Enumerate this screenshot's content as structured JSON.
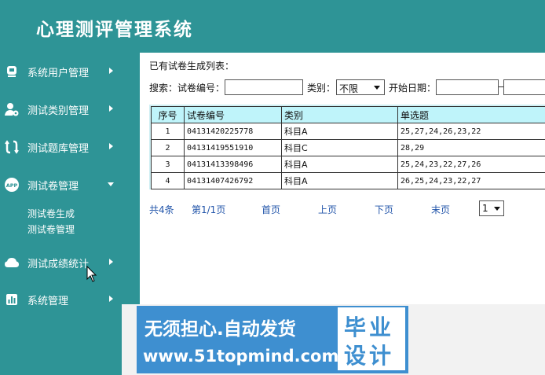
{
  "app": {
    "title": "心理测评管理系统"
  },
  "sidebar": {
    "items": [
      {
        "label": "系统用户管理",
        "icon": "user-icon"
      },
      {
        "label": "测试类别管理",
        "icon": "user-gear-icon"
      },
      {
        "label": "测试题库管理",
        "icon": "bank-icon"
      },
      {
        "label": "测试卷管理",
        "icon": "app-icon",
        "icon_text": "APP"
      },
      {
        "label": "测试成绩统计",
        "icon": "cloud-icon"
      },
      {
        "label": "系统管理",
        "icon": "bar-chart-icon"
      }
    ],
    "subitems": [
      {
        "label": "测试卷生成"
      },
      {
        "label": "测试卷管理"
      }
    ]
  },
  "main": {
    "title": "已有试卷生成列表：",
    "search": {
      "label": "搜索：",
      "id_label": "试卷编号：",
      "id_value": "",
      "type_label": "类别：",
      "type_value": "不限",
      "date_label": "开始日期：",
      "date_from": "",
      "date_to": ""
    },
    "table": {
      "headers": [
        "序号",
        "试卷编号",
        "类别",
        "单选题"
      ],
      "rows": [
        [
          "1",
          "04131420225778",
          "科目A",
          "25,27,24,26,23,22"
        ],
        [
          "2",
          "04131419551910",
          "科目C",
          "28,29"
        ],
        [
          "3",
          "04131413398496",
          "科目A",
          "25,24,23,22,27,26"
        ],
        [
          "4",
          "04131407426792",
          "科目A",
          "26,25,24,23,22,27"
        ]
      ]
    },
    "pager": {
      "total": "共4条",
      "page_info": "第1/1页",
      "first": "首页",
      "prev": "上页",
      "next": "下页",
      "last": "末页",
      "page_value": "1"
    }
  },
  "watermark": {
    "line1": "无须担心.自动发货",
    "line2": "www.51topmind.com",
    "box1": "毕业",
    "box2": "设计"
  },
  "colors": {
    "sidebar": "#2e9496",
    "table_header": "#bff4fa",
    "link": "#2255aa",
    "watermark": "#3e8fd0"
  }
}
